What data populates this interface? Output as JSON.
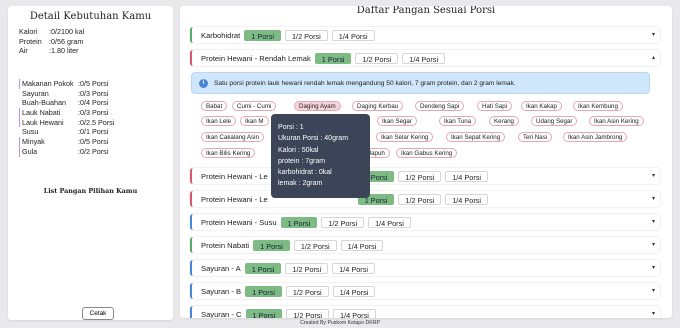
{
  "left": {
    "title": "Detail Kebutuhan Kamu",
    "needs": [
      {
        "label": "Kalori",
        "value": ":0/2100 kal"
      },
      {
        "label": "Protein",
        "value": ":0/56 gram"
      },
      {
        "label": "Air",
        "value": ":1.80 liter"
      }
    ],
    "foods": [
      {
        "label": "Makanan Pokok",
        "value": ":0/5 Porsi",
        "mark": true
      },
      {
        "label": "Sayuran",
        "value": ":0/3 Porsi",
        "mark": false
      },
      {
        "label": "Buah-Buahan",
        "value": ":0/4 Porsi",
        "mark": false
      },
      {
        "label": "Lauk Nabati",
        "value": ":0/3 Porsi",
        "mark": true
      },
      {
        "label": "Lauk Hewani",
        "value": ":0/2.5 Porsi",
        "mark": true
      },
      {
        "label": "Susu",
        "value": ":0/1 Porsi",
        "mark": false
      },
      {
        "label": "Minyak",
        "value": ":0/5 Porsi",
        "mark": true
      },
      {
        "label": "Gula",
        "value": ":0/2 Porsi",
        "mark": true
      }
    ],
    "list_title": "List Pangan Pilihan Kamu",
    "print_label": "Cetak"
  },
  "right": {
    "title": "Daftar Pangan Sesuai Porsi",
    "portions": [
      "1 Porsi",
      "1/2 Porsi",
      "1/4 Porsi"
    ],
    "groups": [
      {
        "title": "Karbohidrat",
        "color": "green",
        "chevron": "▾"
      },
      {
        "title": "Protein Hewani - Rendah Lemak",
        "color": "red",
        "chevron": "▴"
      },
      {
        "title": "Protein Hewani - Le",
        "color": "red",
        "chevron": "▾"
      },
      {
        "title": "Protein Hewani - Le",
        "color": "red",
        "chevron": "▾"
      },
      {
        "title": "Protein Hewani - Susu",
        "color": "blue",
        "chevron": "▾"
      },
      {
        "title": "Protein Nabati",
        "color": "green",
        "chevron": "▾"
      },
      {
        "title": "Sayuran - A",
        "color": "blue",
        "chevron": "▾"
      },
      {
        "title": "Sayuran - B",
        "color": "blue",
        "chevron": "▾"
      },
      {
        "title": "Sayuran - C",
        "color": "blue",
        "chevron": "▾"
      }
    ],
    "info_text": "Satu porsi protein lauk hewani rendah lemak mengandung 50 kalori, 7 gram protein, dan 2 gram lemak.",
    "tags": [
      "Babat",
      "Cumi - Cumi",
      "Daging Ayam",
      "Daging Kerbau",
      "Dendeng Sapi",
      "Hati Sapi",
      "Ikan Kakap",
      "Ikan Kembung",
      "Ikan Lele",
      "Ikan M",
      "ang",
      "Ikan Segar",
      "Ikan Tuna",
      "Kerang",
      "Udang Segar",
      "Ikan Asin Kering",
      "Ikan Cakalang Asin",
      "Ikan Selar Kering",
      "Ikan Sepat Kering",
      "Teri Nasi",
      "Ikan Asin Jambrong",
      "Ikan Bilis Kering",
      "Japuh",
      "Ikan Gabus Kering"
    ],
    "tooltip": [
      "Porsi : 1",
      "Ukuran Porsi : 40gram",
      "Kalori : 50kal",
      "protein : 7gram",
      "karbohidrat : 0kal",
      "lemak : 2gram"
    ]
  },
  "footer": "Created By Puskom Ketapo DKRP"
}
